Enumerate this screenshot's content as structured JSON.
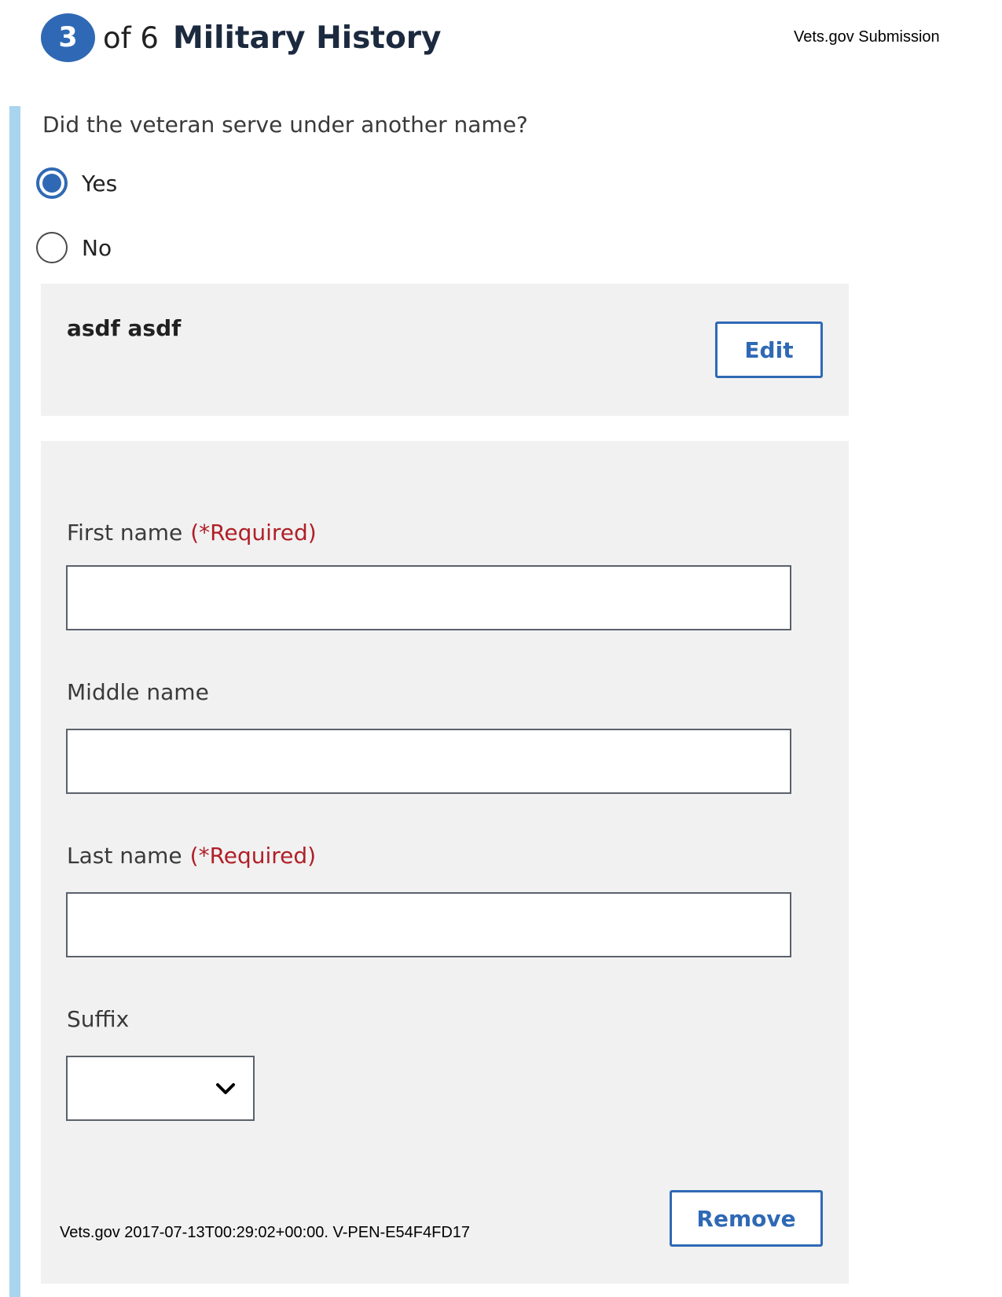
{
  "header": {
    "step_number": "3",
    "step_of": "of 6",
    "title": "Military History",
    "submission_label": "Vets.gov Submission"
  },
  "question": {
    "text": "Did the veteran serve under another name?",
    "options": [
      {
        "label": "Yes",
        "selected": true
      },
      {
        "label": "No",
        "selected": false
      }
    ]
  },
  "saved_entry": {
    "name": "asdf asdf",
    "edit_label": "Edit"
  },
  "form": {
    "first_name": {
      "label": "First name",
      "required": "(*Required)",
      "value": ""
    },
    "middle_name": {
      "label": "Middle name",
      "value": ""
    },
    "last_name": {
      "label": "Last name",
      "required": "(*Required)",
      "value": ""
    },
    "suffix": {
      "label": "Suffix",
      "value": ""
    },
    "remove_label": "Remove"
  },
  "footer": {
    "stamp": "Vets.gov 2017-07-13T00:29:02+00:00. V-PEN-E54F4FD17"
  },
  "colors": {
    "primary": "#2f69b5",
    "required": "#b01f27",
    "accent_bar": "#a9d4ee",
    "card_bg": "#f1f1f1"
  },
  "icons": {
    "suffix_dropdown": "chevron-down-icon"
  }
}
